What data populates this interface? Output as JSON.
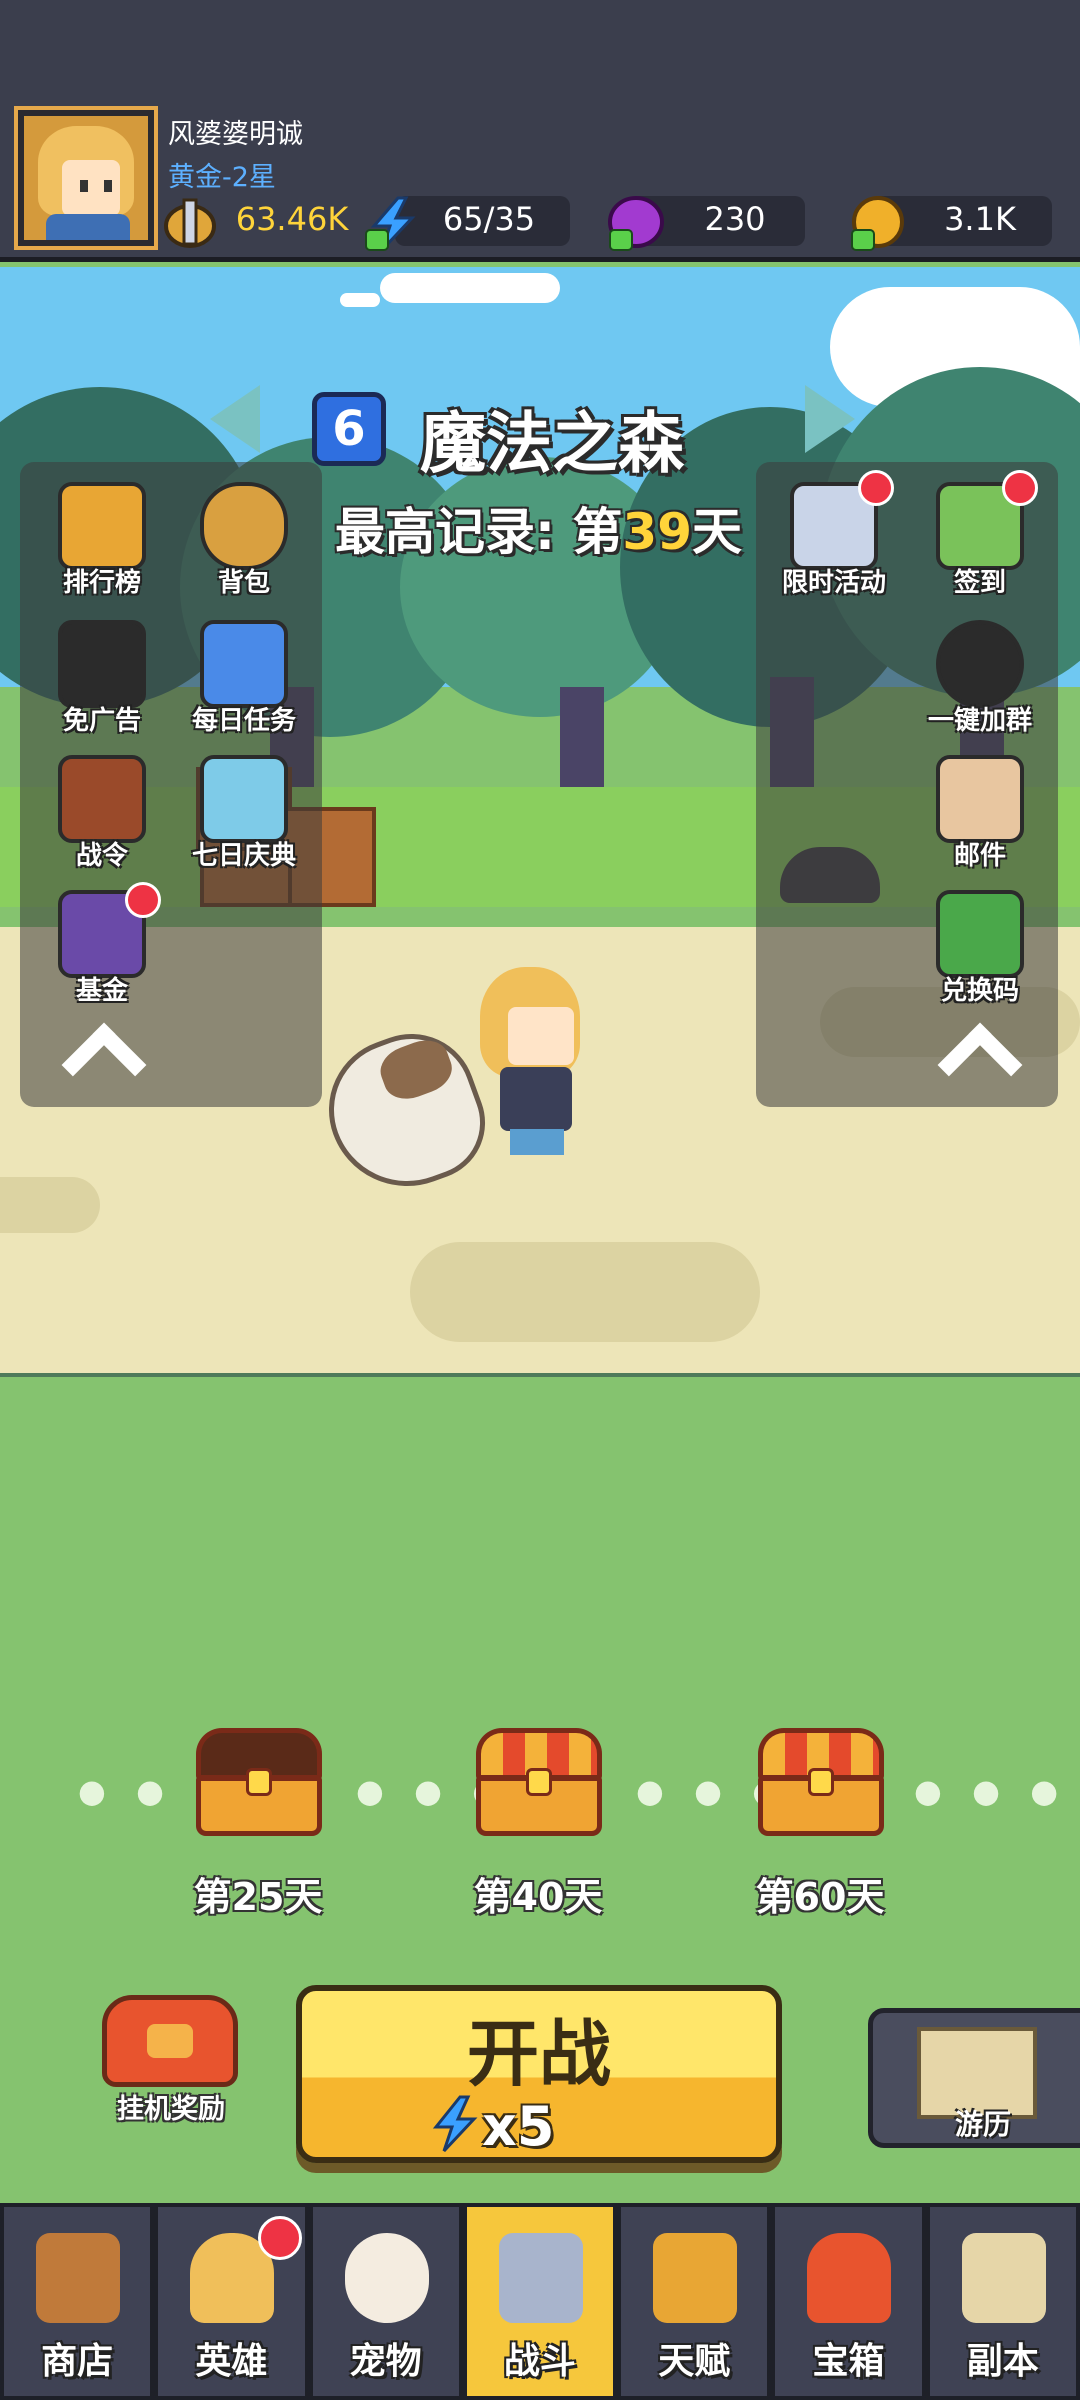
{
  "player": {
    "name": "风婆婆明诚",
    "rank": "黄金-2星",
    "power": "63.46K",
    "energy": "65/35",
    "gems": "230",
    "gold": "3.1K"
  },
  "stage": {
    "level": "6",
    "name": "魔法之森",
    "record_prefix": "最高记录: 第",
    "record_day": "39",
    "record_suffix": "天"
  },
  "left_menu": [
    {
      "label": "排行榜",
      "icon": "leaderboard-icon",
      "color": "#e8a634"
    },
    {
      "label": "背包",
      "icon": "backpack-icon",
      "color": "#d9a040"
    },
    {
      "label": "免广告",
      "icon": "no-ads-icon",
      "color": "#2b2b2b"
    },
    {
      "label": "每日任务",
      "icon": "daily-task-icon",
      "color": "#4a8ae8"
    },
    {
      "label": "战令",
      "icon": "battle-pass-icon",
      "color": "#9a4a2a"
    },
    {
      "label": "七日庆典",
      "icon": "gift-icon",
      "color": "#7ecbe8"
    },
    {
      "label": "基金",
      "icon": "fund-safe-icon",
      "color": "#6a4aa8"
    }
  ],
  "right_menu": [
    {
      "label": "限时活动",
      "icon": "gacha-machine-icon",
      "color": "#c9d4e8"
    },
    {
      "label": "签到",
      "icon": "calendar-icon",
      "color": "#7ac25a"
    },
    {
      "label": "一键加群",
      "icon": "penguin-icon",
      "color": "#2b2b2b"
    },
    {
      "label": "邮件",
      "icon": "mail-scroll-icon",
      "color": "#e8c6a0"
    },
    {
      "label": "兑换码",
      "icon": "redeem-code-icon",
      "color": "#4aa84a"
    }
  ],
  "rewards": [
    {
      "label": "第25天",
      "state": "opened"
    },
    {
      "label": "第40天",
      "state": "locked"
    },
    {
      "label": "第60天",
      "state": "locked"
    }
  ],
  "battle": {
    "idle_reward": "挂机奖励",
    "fight": "开战",
    "cost": "x5",
    "travel": "游历"
  },
  "nav": [
    {
      "label": "商店",
      "icon": "shop-icon"
    },
    {
      "label": "英雄",
      "icon": "hero-icon"
    },
    {
      "label": "宠物",
      "icon": "pet-icon"
    },
    {
      "label": "战斗",
      "icon": "crossed-swords-icon"
    },
    {
      "label": "天赋",
      "icon": "talent-icon"
    },
    {
      "label": "宝箱",
      "icon": "chest-icon"
    },
    {
      "label": "副本",
      "icon": "dungeon-map-icon"
    }
  ],
  "nav_active": "战斗",
  "colors": {
    "accent": "#f6c73c",
    "notification": "#ee3344",
    "rank": "#5db0ff",
    "record_day": "#ffd43a"
  }
}
